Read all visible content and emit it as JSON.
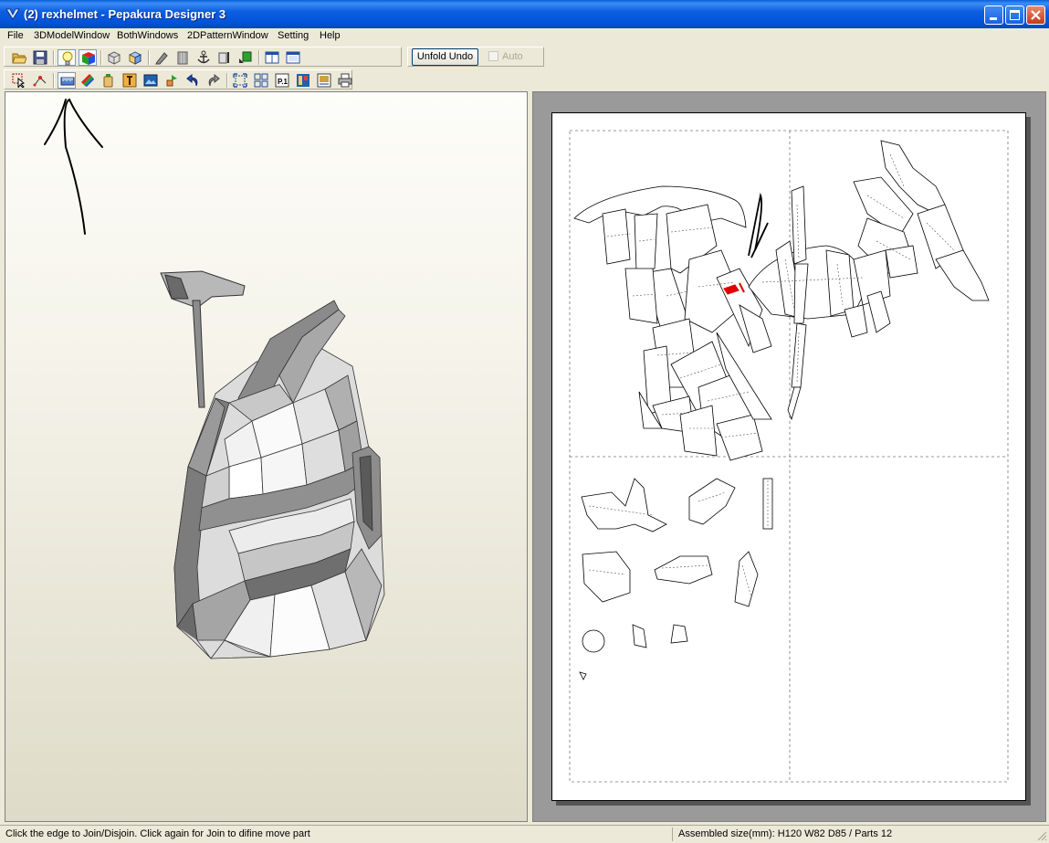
{
  "window": {
    "title": "(2) rexhelmet - Pepakura Designer 3"
  },
  "menu": {
    "items": [
      "File",
      "3DModelWindow",
      "BothWindows",
      "2DPatternWindow",
      "Setting",
      "Help"
    ]
  },
  "toolbar": {
    "unfold_undo_label": "Unfold Undo",
    "auto_label": "Auto",
    "row1_icons": [
      "open-folder-icon",
      "save-disk-icon",
      "lightbulb-icon",
      "color-cube-icon",
      "wireframe-cube-icon",
      "textured-cube-icon",
      "pencil-icon",
      "glue-flap-icon",
      "anchor-icon",
      "fold-line-icon",
      "move-part-icon",
      "single-window-icon",
      "split-window-icon"
    ],
    "row2_icons": [
      "select-arrow-icon",
      "join-edge-icon",
      "ruler-icon",
      "color-stripes-icon",
      "bottle-icon",
      "text-box-icon",
      "image-icon",
      "rotate-part-icon",
      "undo-arrow-icon",
      "redo-arrow-icon",
      "fit-page-icon",
      "arrange-parts-icon",
      "page-number-icon",
      "layout-icon",
      "print-preview-icon",
      "printer-icon"
    ]
  },
  "status": {
    "message": "Click the edge to Join/Disjoin. Click again for Join to difine move part",
    "assembled_size": "Assembled size(mm): H120 W82 D85 / Parts 12"
  },
  "colors": {
    "titlebar": "#0053d9",
    "chrome": "#ece9d8",
    "pattern_bg": "#9a9a9a",
    "highlight_red": "#e00000"
  }
}
